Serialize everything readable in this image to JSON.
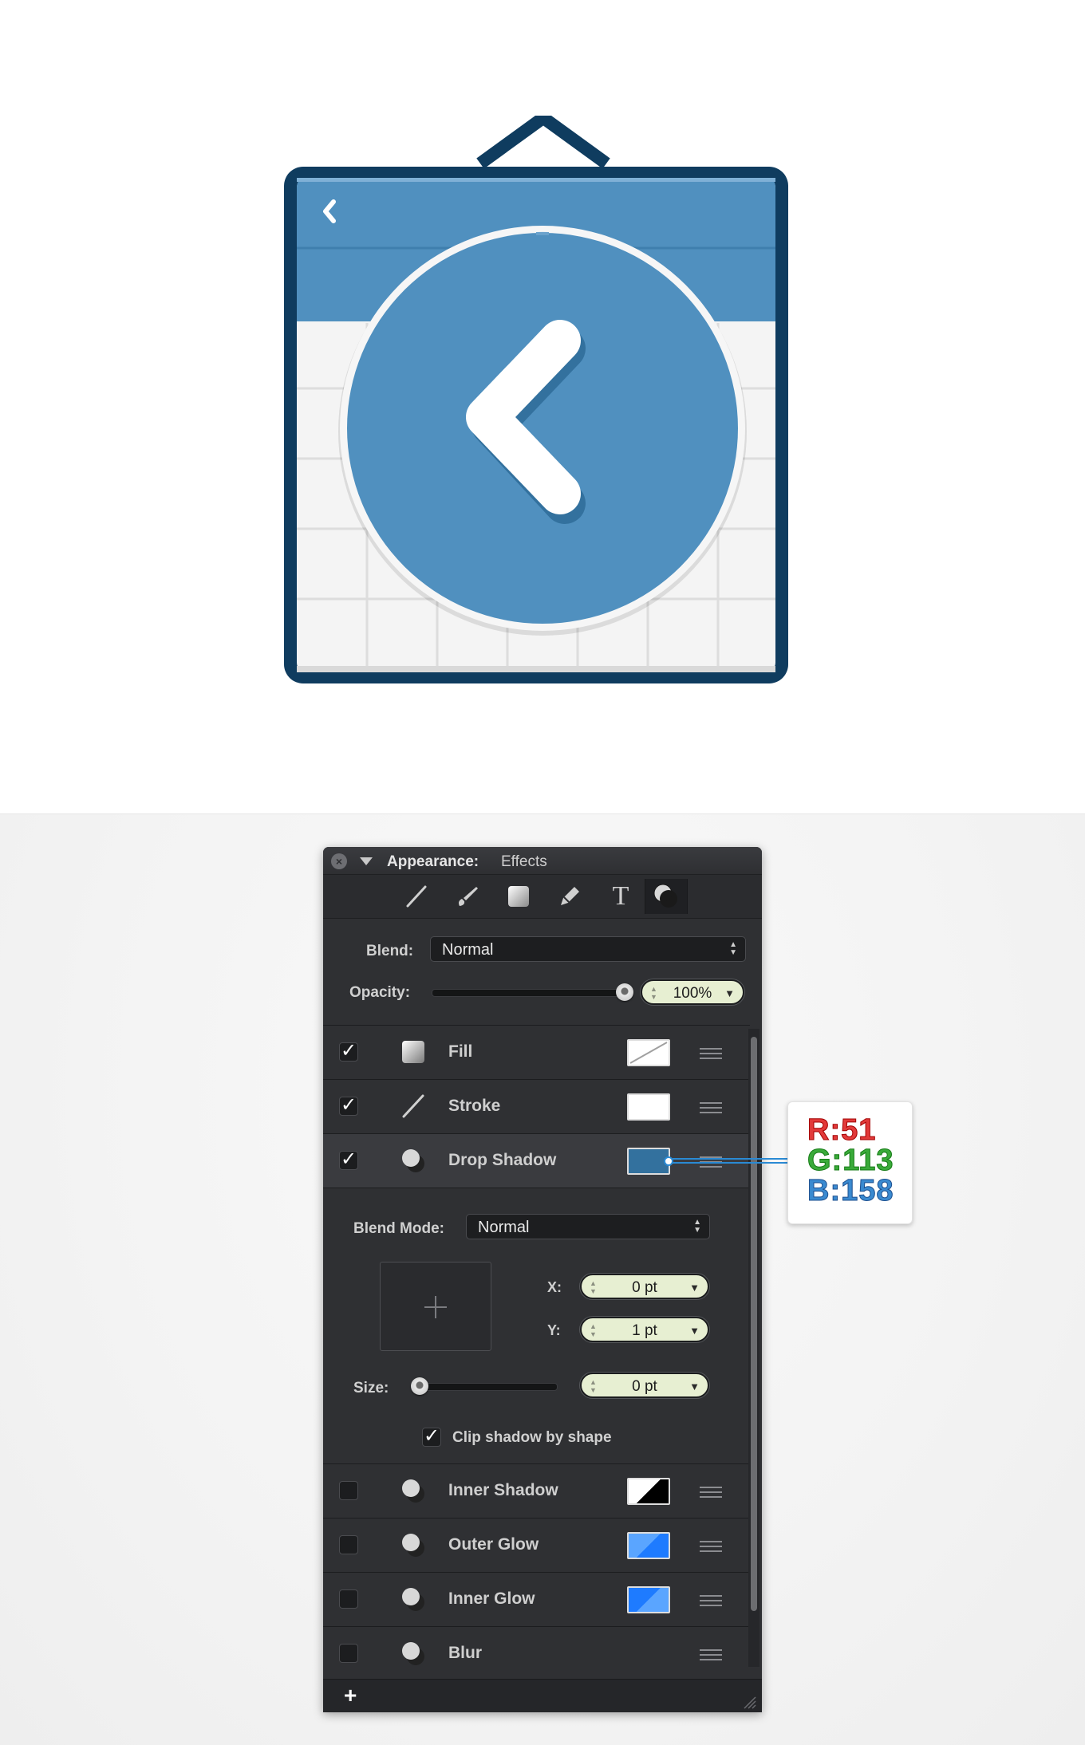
{
  "panel": {
    "title": "Appearance:",
    "subtitle": "Effects",
    "tools": [
      "stroke-tool-icon",
      "brush-tool-icon",
      "fill-tool-icon",
      "pen-tool-icon",
      "text-tool-icon",
      "effects-tool-icon"
    ],
    "text_tool_glyph": "T",
    "blend_label": "Blend:",
    "blend_value": "Normal",
    "opacity_label": "Opacity:",
    "opacity_value": "100%",
    "opacity_fraction": 1.0,
    "effects": [
      {
        "label": "Fill",
        "checked": true,
        "swatch": "none"
      },
      {
        "label": "Stroke",
        "checked": true,
        "swatch": "#ffffff"
      },
      {
        "label": "Drop Shadow",
        "checked": true,
        "swatch": "#33719e"
      },
      {
        "label": "Inner Shadow",
        "checked": false,
        "swatch": "#000000"
      },
      {
        "label": "Outer Glow",
        "checked": false,
        "swatch": "#1e7bff"
      },
      {
        "label": "Inner Glow",
        "checked": false,
        "swatch": "#1e7bff"
      },
      {
        "label": "Blur",
        "checked": false,
        "swatch": ""
      }
    ],
    "drop_shadow": {
      "blend_mode_label": "Blend Mode:",
      "blend_mode_value": "Normal",
      "x_label": "X:",
      "x_value": "0 pt",
      "y_label": "Y:",
      "y_value": "1 pt",
      "size_label": "Size:",
      "size_value": "0 pt",
      "size_fraction": 0.0,
      "clip_label": "Clip shadow by shape",
      "clip_checked": true
    },
    "add_label": "+"
  },
  "callout": {
    "r": "R:51",
    "g": "G:113",
    "b": "B:158"
  },
  "colors": {
    "icon_frame": "#0f3c5f",
    "icon_blue": "#5090bf",
    "icon_shadow": "#33719e",
    "calendar_bg": "#f4f4f4",
    "panel_bg": "#2f3033",
    "stepper_bg": "#e7efd2"
  }
}
